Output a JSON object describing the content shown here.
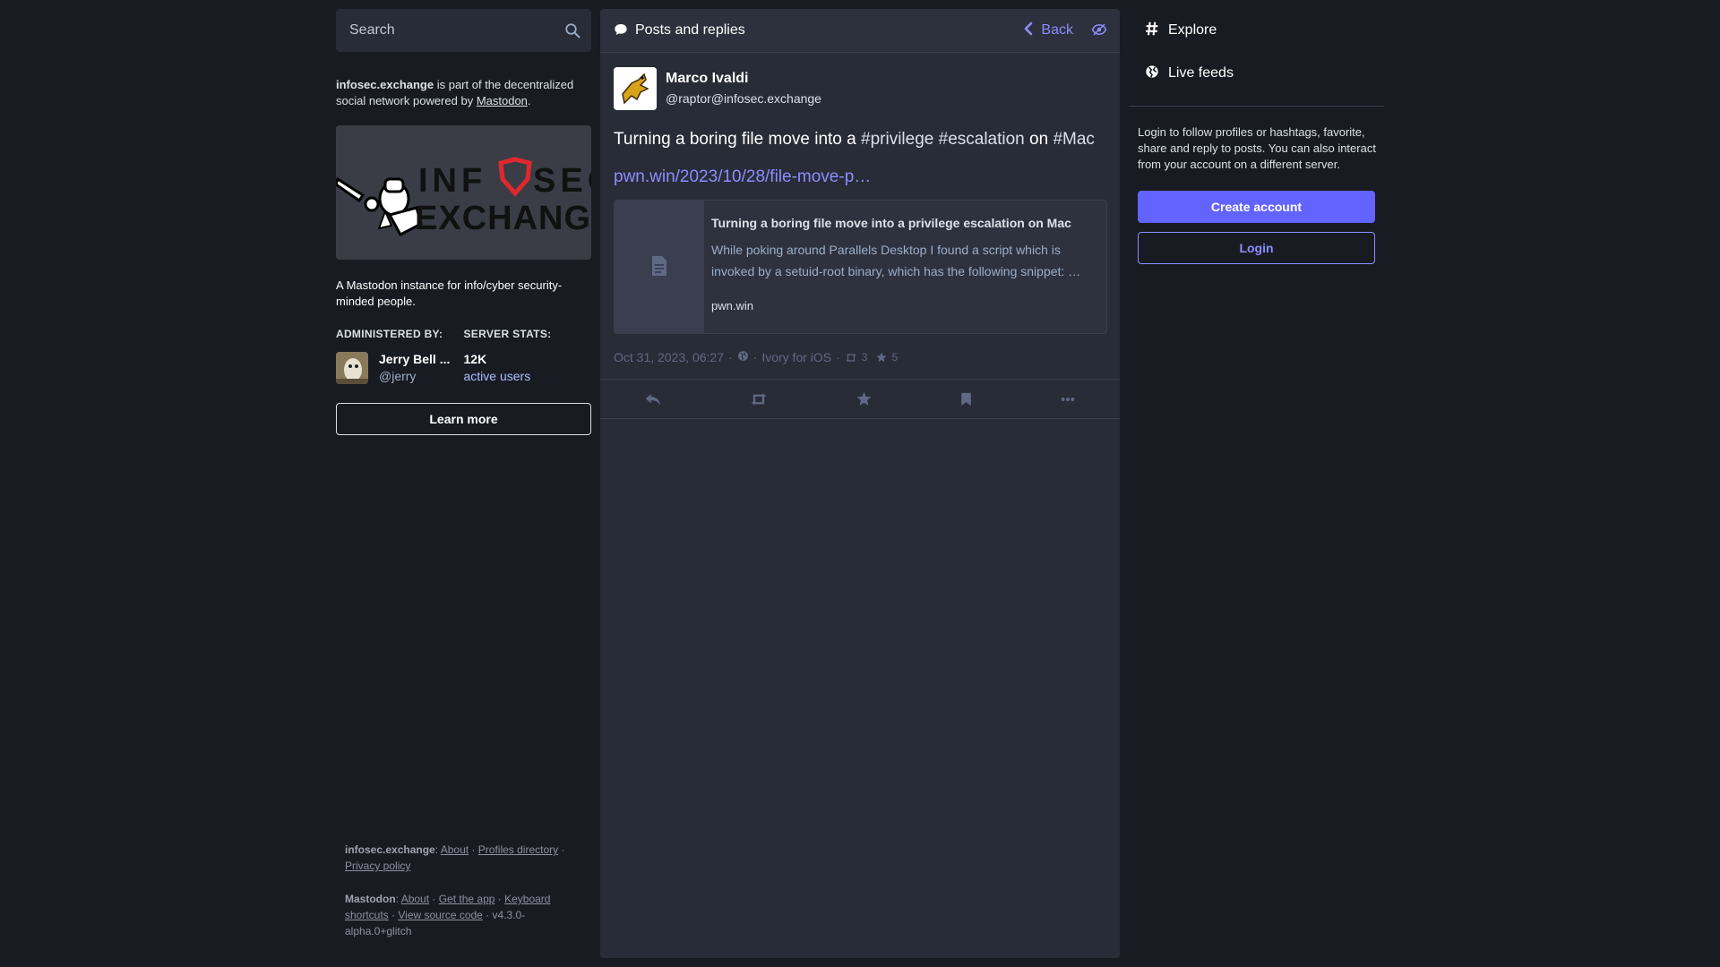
{
  "search": {
    "placeholder": "Search"
  },
  "server": {
    "domain": "infosec.exchange",
    "about_mid": " is part of the decentralized social network powered by ",
    "mastodon_link": "Mastodon",
    "about_end": ".",
    "hero_alt": "INFOSEC EXCHANGE",
    "description": "A Mastodon instance for info/cyber security-minded people.",
    "admin_heading": "ADMINISTERED BY:",
    "stats_heading": "SERVER STATS:",
    "admin_name": "Jerry Bell ...",
    "admin_handle": "@jerry",
    "active_users_value": "12K",
    "active_users_label": "active users",
    "learn_more": "Learn more"
  },
  "footer": {
    "domain": "infosec.exchange",
    "about": "About",
    "profiles_directory": "Profiles directory",
    "privacy_policy": "Privacy policy",
    "mastodon": "Mastodon",
    "mastodon_about": "About",
    "get_app": "Get the app",
    "keyboard_shortcuts": "Keyboard shortcuts",
    "view_source": "View source code",
    "version": "v4.3.0-alpha.0+glitch"
  },
  "column": {
    "title": "Posts and replies",
    "back": "Back",
    "icons": {
      "title": "comment-icon",
      "back": "chevron-left-icon",
      "hide": "eye-slash-icon"
    }
  },
  "post": {
    "display_name": "Marco Ivaldi",
    "acct": "@raptor@infosec.exchange",
    "text_prefix": "Turning a boring file move into a ",
    "tag1": "#privilege",
    "tag2": "#escalation",
    "text_on": " on ",
    "tag3": "#Mac",
    "link": "pwn.win/2023/10/28/file-move-p…",
    "card": {
      "title": "Turning a boring file move into a privilege escalation on Mac",
      "description": "While poking around Parallels Desktop I found a script which is invoked by a setuid-root binary, which has the following snippet: …",
      "host": "pwn.win"
    },
    "meta": {
      "date": "Oct 31, 2023, 06:27",
      "dot": "·",
      "app": "Ivory for iOS",
      "boosts": "3",
      "favourites": "5"
    }
  },
  "nav": {
    "explore": "Explore",
    "live_feeds": "Live feeds",
    "icons": {
      "explore": "hashtag-icon",
      "live_feeds": "globe-icon"
    }
  },
  "signup": {
    "text": "Login to follow profiles or hashtags, favorite, share and reply to posts. You can also interact from your account on a different server.",
    "create_account": "Create account",
    "login": "Login"
  },
  "colors": {
    "background": "#191b22",
    "column": "#282c37",
    "accent": "#6364ff",
    "link": "#8c8dff"
  }
}
